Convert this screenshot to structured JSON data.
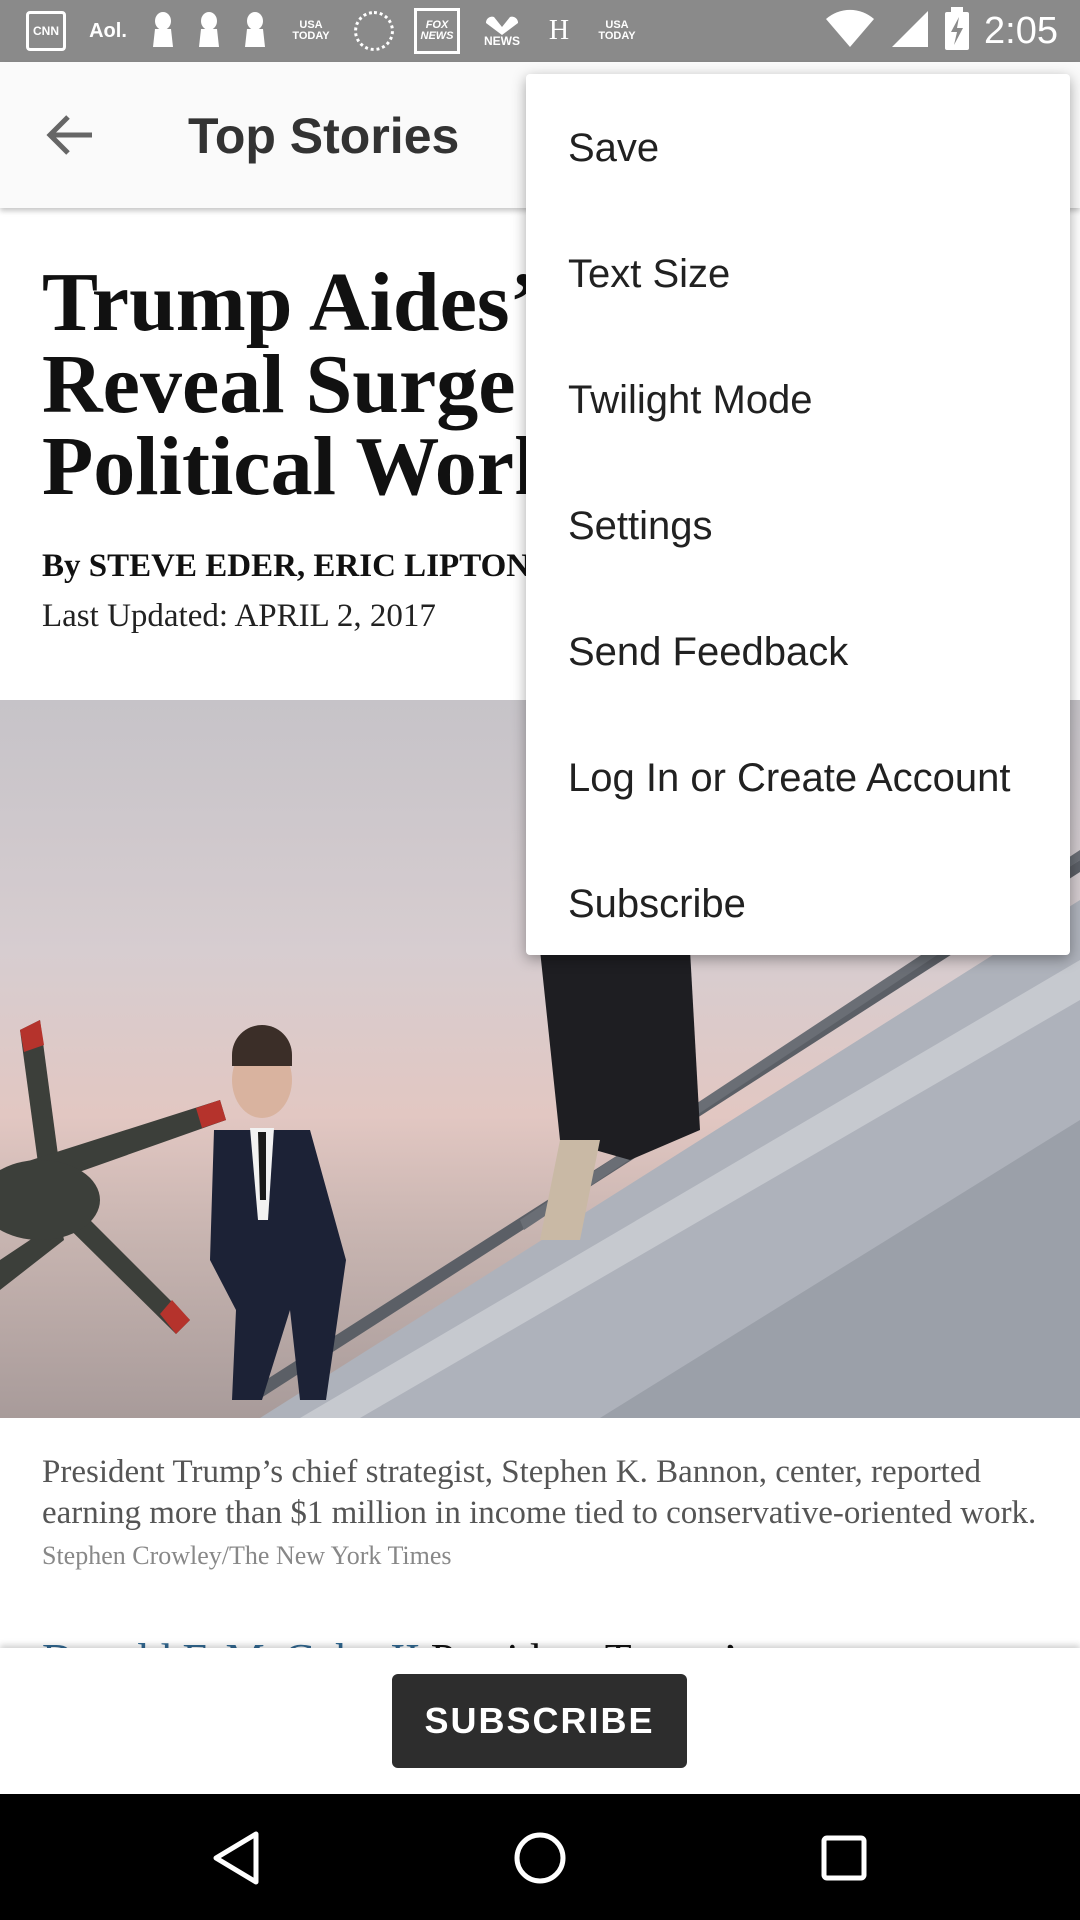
{
  "status_bar": {
    "time": "2:05",
    "notification_icons": [
      "CNN",
      "Aol.",
      "",
      "",
      "",
      "USA TODAY",
      "",
      "FOX NEWS",
      "NEWS",
      "H",
      "USA TODAY"
    ],
    "icon_names": [
      "cnn-icon",
      "aol-icon",
      "pin-icon",
      "pin-icon",
      "pin-icon",
      "usa-today-icon",
      "wheel-icon",
      "fox-news-icon",
      "nbc-news-icon",
      "h-icon",
      "usa-today-icon"
    ],
    "status_icons": [
      "wifi-icon",
      "signal-icon",
      "battery-charging-icon"
    ]
  },
  "app_bar": {
    "title": "Top Stories",
    "back_icon": "arrow-back-icon"
  },
  "article": {
    "headline_lines": [
      "Trump Aides’ I",
      "Reveal Surge in",
      "Political Work"
    ],
    "byline": "By STEVE EDER, ERIC LIPTON",
    "updated": "Last Updated: APRIL 2, 2017",
    "caption": "President Trump’s chief strategist, Stephen K. Bannon, center, reported earning more than $1 million in income tied to conservative-oriented work.",
    "photo_credit": "Stephen Crowley/The New York Times",
    "partial_link": "Donald F. McGahn II",
    "partial_text": " President Trump’s"
  },
  "subscribe_bar": {
    "button_label": "SUBSCRIBE"
  },
  "overflow_menu": {
    "items": [
      "Save",
      "Text Size",
      "Twilight Mode",
      "Settings",
      "Send Feedback",
      "Log In or Create Account",
      "Subscribe"
    ]
  },
  "nav_bar": {
    "icons": [
      "back-triangle-icon",
      "home-circle-icon",
      "recents-square-icon"
    ]
  },
  "colors": {
    "status_bar": "#8a8a8a",
    "app_bar": "#fafafa",
    "link": "#326891",
    "subscribe_button": "#2d2d2d",
    "nav_bar": "#000000"
  }
}
